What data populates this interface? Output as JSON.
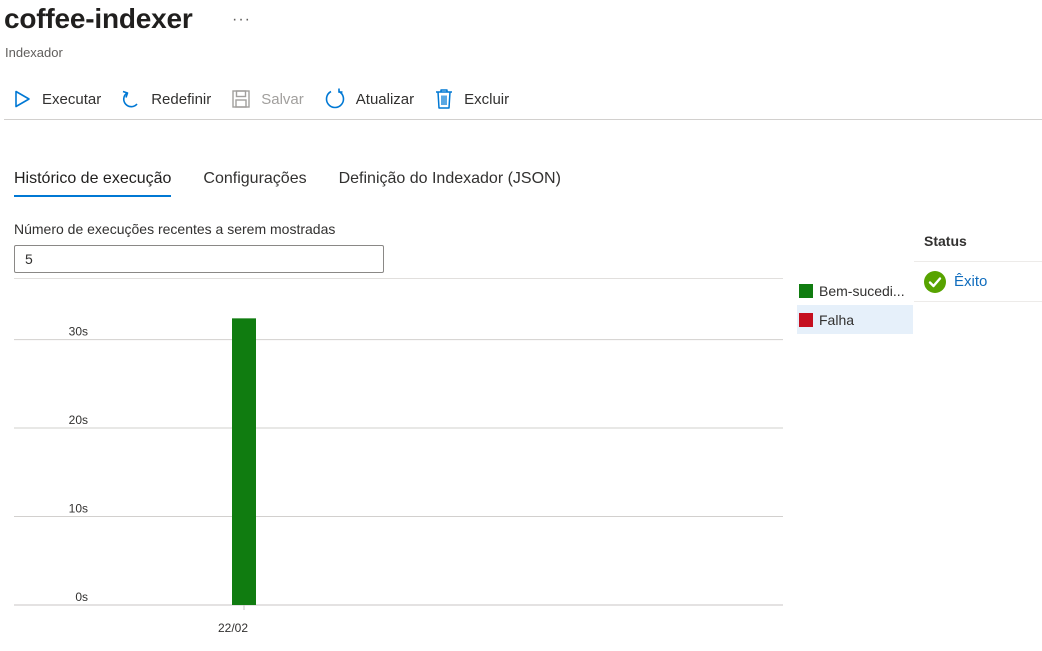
{
  "header": {
    "title": "coffee-indexer",
    "more": "···",
    "subtitle": "Indexador"
  },
  "toolbar": {
    "run_label": "Executar",
    "reset_label": "Redefinir",
    "save_label": "Salvar",
    "refresh_label": "Atualizar",
    "delete_label": "Excluir",
    "icon_color": "#0078d4"
  },
  "tabs": [
    {
      "label": "Histórico de execução",
      "active": true
    },
    {
      "label": "Configurações",
      "active": false
    },
    {
      "label": "Definição do Indexador (JSON)",
      "active": false
    }
  ],
  "runs": {
    "label": "Número de execuções recentes a serem mostradas",
    "value": "5"
  },
  "legend": [
    {
      "label": "Bem-sucedi...",
      "color": "#107c10"
    },
    {
      "label": "Falha",
      "color": "#c50f1f"
    }
  ],
  "status": {
    "header": "Status",
    "value": "Êxito",
    "icon": "check-circle-icon",
    "color": "#57a300"
  },
  "chart_data": {
    "type": "bar",
    "categories": [
      "22/02"
    ],
    "series": [
      {
        "name": "Bem-sucedi...",
        "values": [
          32.4
        ],
        "color": "#107c10"
      },
      {
        "name": "Falha",
        "values": [
          0
        ],
        "color": "#c50f1f"
      }
    ],
    "yticks": [
      "0s",
      "10s",
      "20s",
      "30s"
    ],
    "ytick_values": [
      0,
      10,
      20,
      30
    ],
    "ylim": [
      0,
      34.7
    ],
    "grid": true,
    "legend_position": "right"
  }
}
